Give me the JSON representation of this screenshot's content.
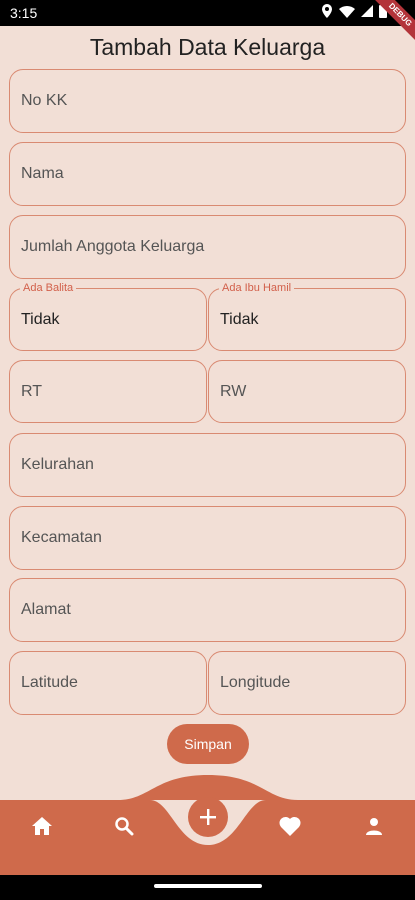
{
  "status": {
    "time": "3:15",
    "debug_label": "DEBUG"
  },
  "page": {
    "title": "Tambah Data Keluarga"
  },
  "form": {
    "no_kk": "No KK",
    "nama": "Nama",
    "jumlah": "Jumlah Anggota Keluarga",
    "balita": {
      "label": "Ada Balita",
      "value": "Tidak"
    },
    "ibu_hamil": {
      "label": "Ada Ibu Hamil",
      "value": "Tidak"
    },
    "rt": "RT",
    "rw": "RW",
    "kelurahan": "Kelurahan",
    "kecamatan": "Kecamatan",
    "alamat": "Alamat",
    "latitude": "Latitude",
    "longitude": "Longitude",
    "submit_label": "Simpan"
  },
  "nav": {
    "items": [
      "home-icon",
      "search-icon",
      "add-icon",
      "heart-icon",
      "person-icon"
    ]
  },
  "colors": {
    "background": "#f2dfd6",
    "accent": "#cf6a4b",
    "border": "#d98a72"
  }
}
